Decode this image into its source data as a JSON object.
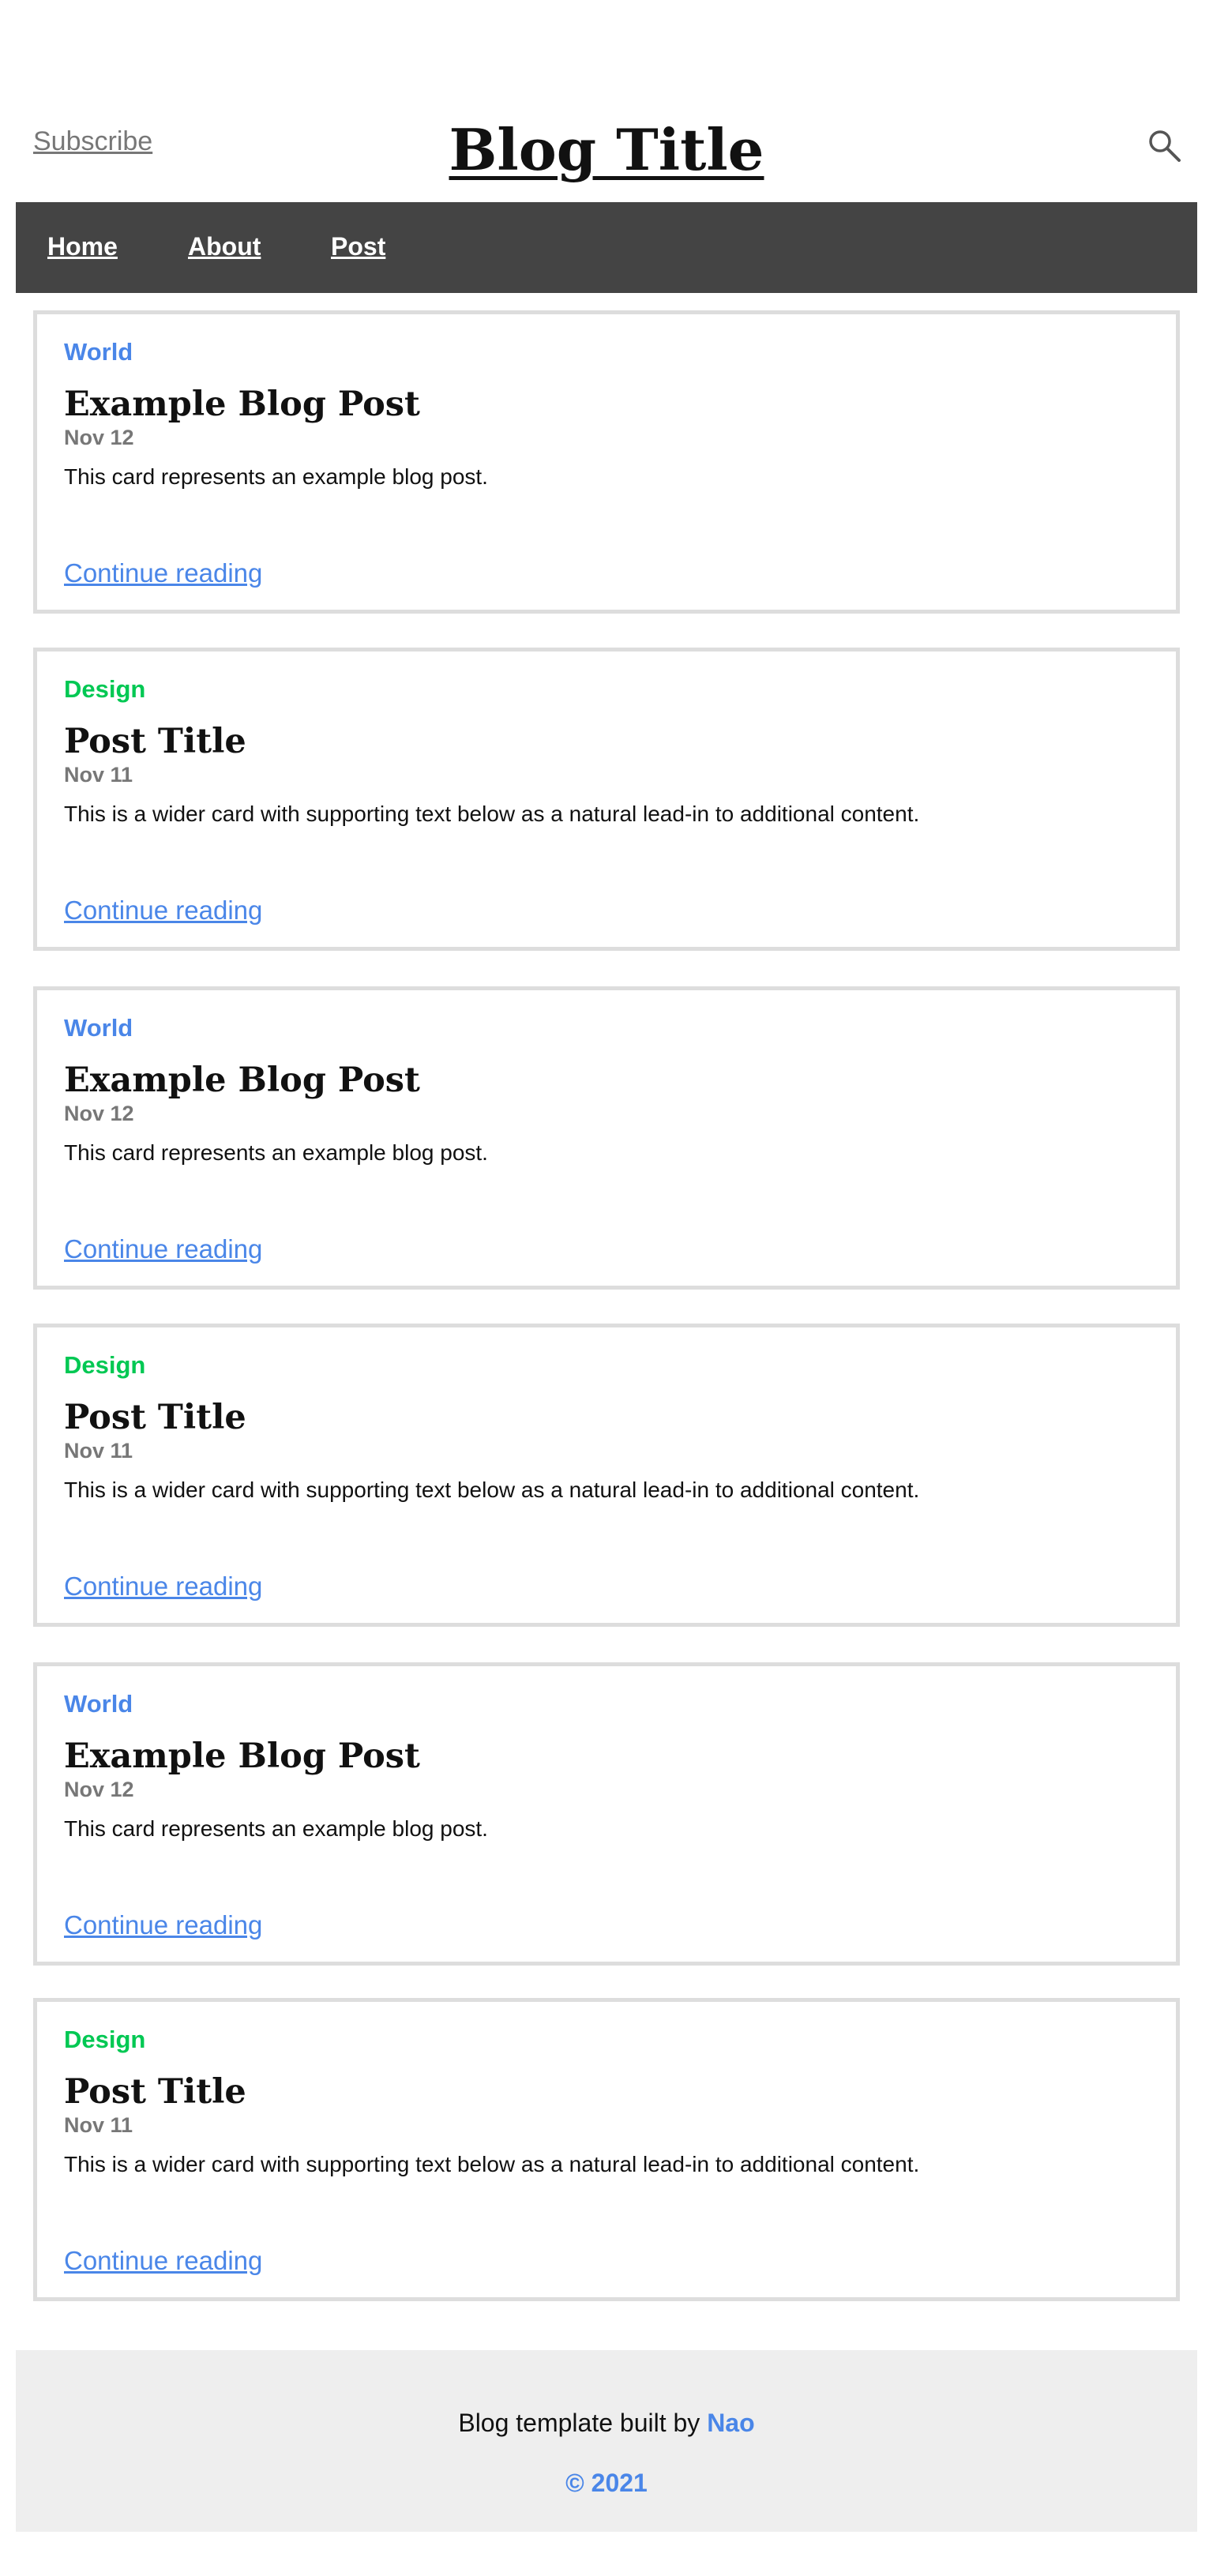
{
  "header": {
    "subscribe_label": "Subscribe",
    "title": "Blog Title",
    "search_icon": "search-icon"
  },
  "nav": {
    "items": [
      {
        "label": "Home"
      },
      {
        "label": "About"
      },
      {
        "label": "Post"
      }
    ]
  },
  "cards": [
    {
      "category": "World",
      "title": "Example Blog Post",
      "date": "Nov 12",
      "text": "This card represents an example blog post.",
      "link": "Continue reading"
    },
    {
      "category": "Design",
      "title": "Post Title",
      "date": "Nov 11",
      "text": "This is a wider card with supporting text below as a natural lead-in to additional content.",
      "link": "Continue reading"
    },
    {
      "category": "World",
      "title": "Example Blog Post",
      "date": "Nov 12",
      "text": "This card represents an example blog post.",
      "link": "Continue reading"
    },
    {
      "category": "Design",
      "title": "Post Title",
      "date": "Nov 11",
      "text": "This is a wider card with supporting text below as a natural lead-in to additional content.",
      "link": "Continue reading"
    },
    {
      "category": "World",
      "title": "Example Blog Post",
      "date": "Nov 12",
      "text": "This card represents an example blog post.",
      "link": "Continue reading"
    },
    {
      "category": "Design",
      "title": "Post Title",
      "date": "Nov 11",
      "text": "This is a wider card with supporting text below as a natural lead-in to additional content.",
      "link": "Continue reading"
    }
  ],
  "footer": {
    "text": "Blog template built by",
    "author": "Nao",
    "copyright": "© 2021"
  },
  "colors": {
    "nav_background": "#444444",
    "link": "#4a86e8",
    "category_world": "#4a86e8",
    "category_design": "#00c853",
    "card_border": "#dddddd",
    "footer_background": "#eeeeee",
    "muted_text": "#777777"
  }
}
